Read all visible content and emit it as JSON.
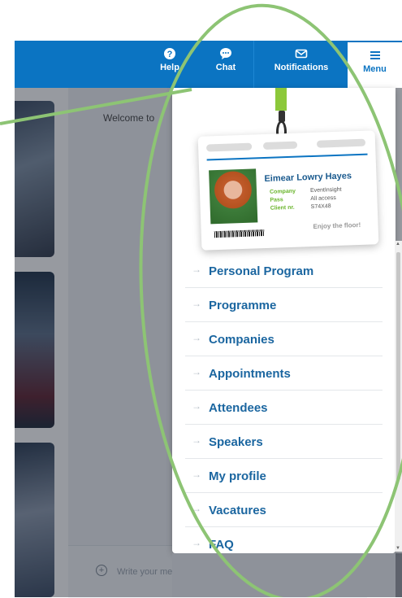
{
  "topbar": {
    "help_label": "Help",
    "chat_label": "Chat",
    "notifications_label": "Notifications",
    "menu_label": "Menu"
  },
  "chat": {
    "welcome_text": "Welcome to",
    "message_placeholder": "Write your message"
  },
  "badge": {
    "name": "Eimear Lowry Hayes",
    "rows": [
      {
        "label": "Company",
        "value": "EventInsight"
      },
      {
        "label": "Pass",
        "value": "All access"
      },
      {
        "label": "Client nr.",
        "value": "S74X48"
      }
    ],
    "tagline": "Enjoy the floor!"
  },
  "menu": {
    "items": [
      {
        "label": "Personal Program"
      },
      {
        "label": "Programme"
      },
      {
        "label": "Companies"
      },
      {
        "label": "Appointments"
      },
      {
        "label": "Attendees"
      },
      {
        "label": "Speakers"
      },
      {
        "label": "My profile"
      },
      {
        "label": "Vacatures"
      },
      {
        "label": "FAQ"
      }
    ]
  },
  "colors": {
    "brand": "#0b74c2",
    "accent_green": "#8cc83a",
    "annotation": "#8dc474"
  },
  "icons": [
    "help-icon",
    "chat-bubble-icon",
    "envelope-icon",
    "hamburger-icon",
    "plus-circle-icon",
    "arrow-right-icon"
  ]
}
